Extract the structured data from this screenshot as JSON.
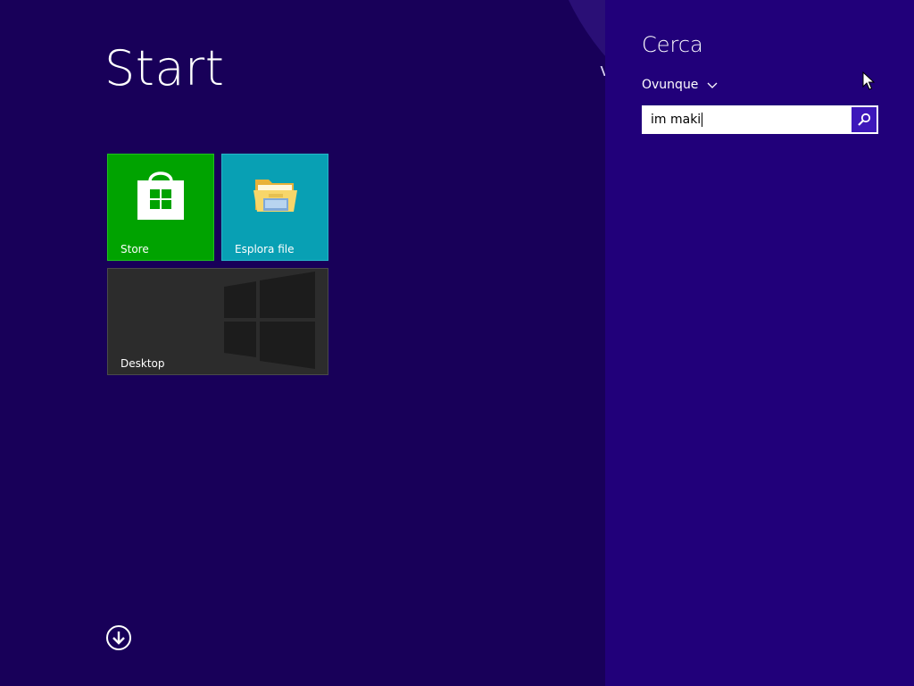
{
  "start": {
    "title": "Start",
    "username_hint": "v",
    "tiles": [
      {
        "label": "Store",
        "icon": "store-bag-icon",
        "color": "#00a300"
      },
      {
        "label": "Esplora file",
        "icon": "folder-icon",
        "color": "#08a0b4"
      },
      {
        "label": "Desktop",
        "icon": "windows-logo-icon",
        "color": "#2c2c2c"
      }
    ],
    "all_apps_icon": "arrow-down-circle-icon"
  },
  "search_charm": {
    "title": "Cerca",
    "scope": "Ovunque",
    "scope_icon": "chevron-down-icon",
    "query": "im maki",
    "search_icon": "magnifier-icon",
    "accent": "#3d17ba",
    "background": "#21007a"
  },
  "colors": {
    "start_background": "#180059"
  }
}
